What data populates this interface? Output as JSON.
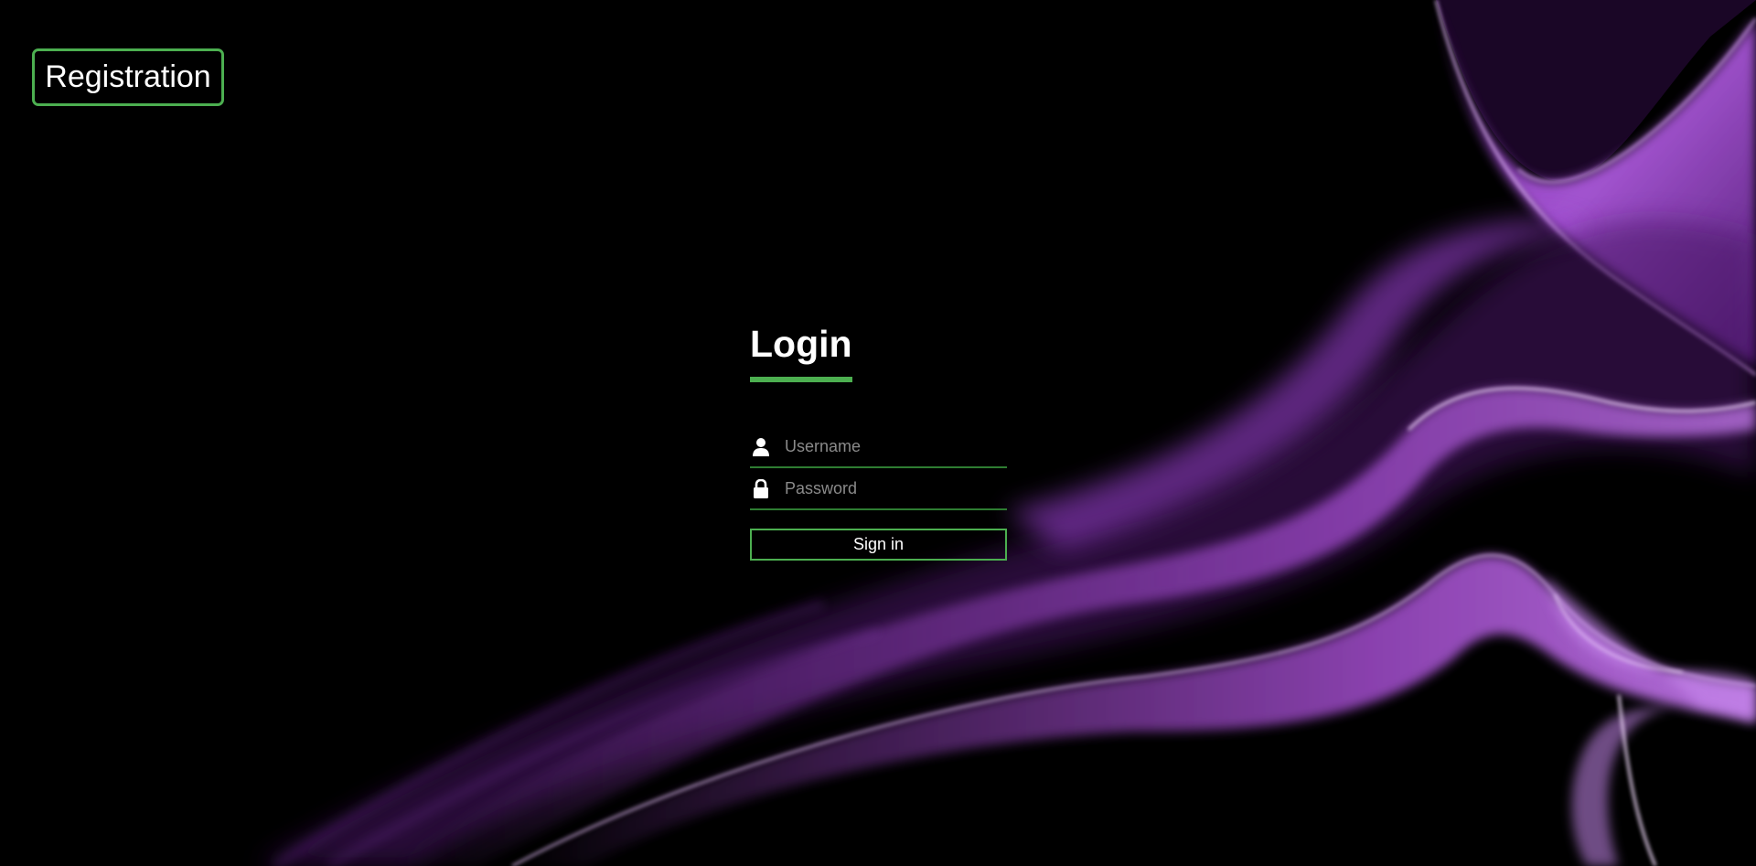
{
  "header": {
    "registration_label": "Registration"
  },
  "login": {
    "title": "Login",
    "username": {
      "placeholder": "Username",
      "value": "",
      "icon": "user-icon"
    },
    "password": {
      "placeholder": "Password",
      "value": "",
      "icon": "lock-icon"
    },
    "signin_label": "Sign in"
  },
  "colors": {
    "background": "#000000",
    "accent": "#4caf50",
    "text": "#ffffff",
    "placeholder": "#8a8a8a",
    "smoke": "#b04fe0"
  }
}
